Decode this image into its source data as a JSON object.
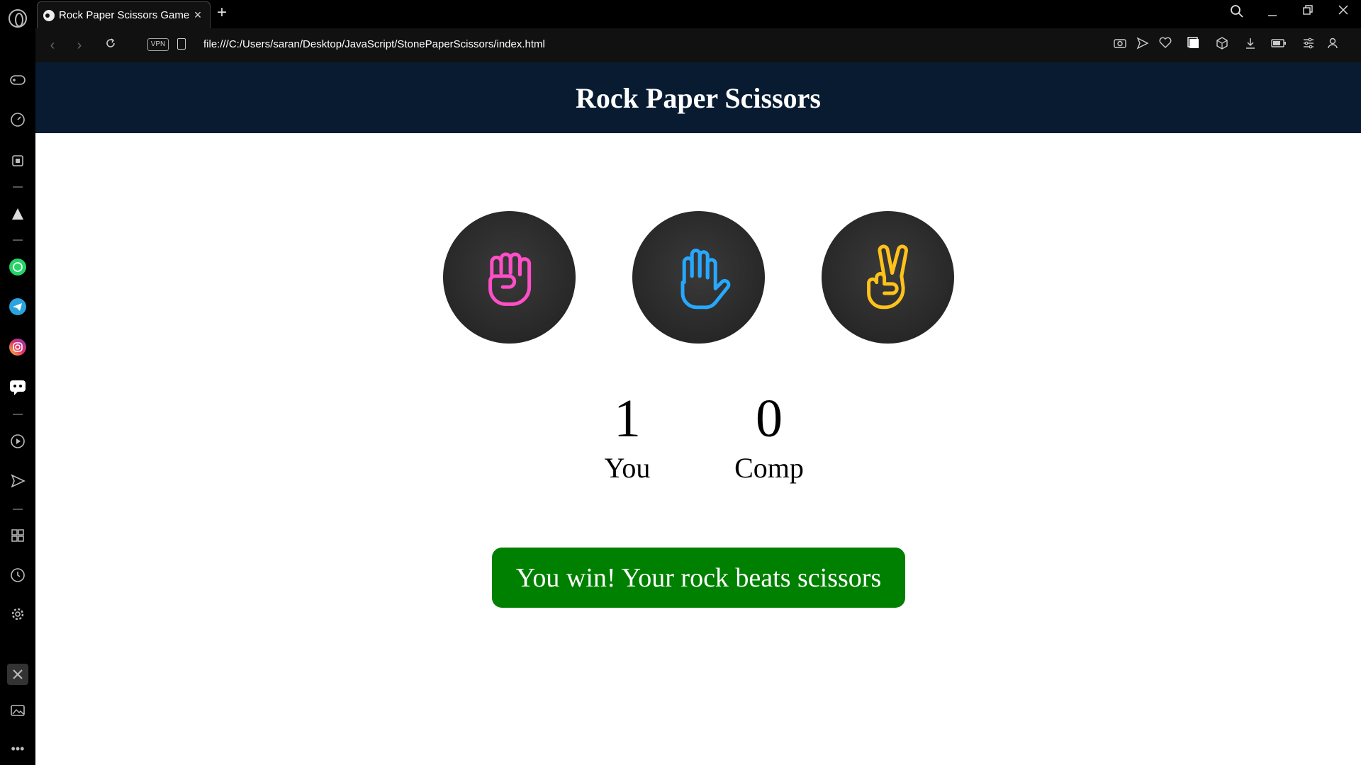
{
  "browser": {
    "tab_title": "Rock Paper Scissors Game",
    "tab_close": "×",
    "new_tab": "+",
    "url": "file:///C:/Users/saran/Desktop/JavaScript/StonePaperScissors/index.html",
    "vpn_label": "VPN"
  },
  "page": {
    "heading": "Rock Paper Scissors",
    "choices": [
      {
        "name": "rock",
        "icon": "fist-icon",
        "color": "#ff4fc7"
      },
      {
        "name": "paper",
        "icon": "open-hand-icon",
        "color": "#27a8ff"
      },
      {
        "name": "scissors",
        "icon": "peace-hand-icon",
        "color": "#ffc21a"
      }
    ],
    "score": {
      "user_score": "1",
      "user_label": "You",
      "comp_score": "0",
      "comp_label": "Comp"
    },
    "message": "You win! Your rock beats scissors",
    "message_color": "#008000"
  }
}
